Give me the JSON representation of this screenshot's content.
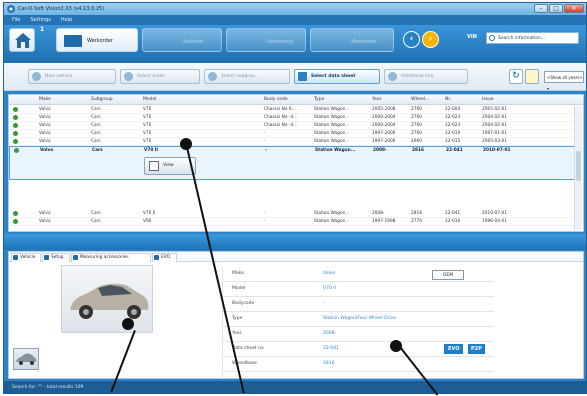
{
  "window": {
    "title": "Car-O-Soft Vision2 X3 (v4.13.0.25)",
    "buttons": [
      "–",
      "□",
      "✕"
    ]
  },
  "menu": [
    "File",
    "Settings",
    "Help"
  ],
  "toolbar": {
    "tab_number": "1",
    "active_tab": "Werkorder",
    "ghost_tabs": [
      "Selectie",
      "Uitvoering",
      "Werkorder"
    ],
    "vin_label": "VIN",
    "search_placeholder": "Search information..."
  },
  "breadcrumbs": [
    "New vehicle",
    "Select make",
    "Select subgrou...",
    "Select data sheet",
    "Additional info"
  ],
  "year_filter": "<Show all years>",
  "grid": {
    "headers": [
      "Make",
      "Subgroup",
      "Model",
      "Body code",
      "Type",
      "Year",
      "Wheel...",
      "Nr.",
      "Issue"
    ],
    "rows": [
      [
        "Volvo",
        "Cars",
        "V70",
        "Chassis No 6...",
        "Station Wagon...",
        "2005-2008",
        "2760",
        "22-004",
        "2005-02-01"
      ],
      [
        "Volvo",
        "Cars",
        "V70",
        "Chassis No -4...",
        "Station Wagon...",
        "2000-2004",
        "2760",
        "22-023",
        "2004-02-01"
      ],
      [
        "Volvo",
        "Cars",
        "V70",
        "Chassis No -4...",
        "Station Wagon...",
        "2000-2004",
        "2760",
        "22-023",
        "2004-02-01"
      ],
      [
        "Volvo",
        "Cars",
        "V70",
        "-",
        "Station Wagon...",
        "1997-2000",
        "2760",
        "22-019",
        "1997-01-01"
      ],
      [
        "Volvo",
        "Cars",
        "V70",
        "-",
        "Station Wagon...",
        "1997-2000",
        "2660",
        "22-015",
        "2005-03-01"
      ]
    ],
    "selected_row": [
      "Volvo",
      "Cars",
      "V70 II",
      "-",
      "Station Wagon...",
      "2008-",
      "2816",
      "22-041",
      "2010-07-01"
    ],
    "view_button": "View",
    "after_rows": [
      [
        "Volvo",
        "Cars",
        "V70 II",
        "-",
        "Station Wagon...",
        "2008-",
        "2816",
        "22-041",
        "2010-07-01"
      ],
      [
        "Volvo",
        "Cars",
        "V90",
        "-",
        "Station Wagon...",
        "1997-1998",
        "2770",
        "22-016",
        "1996-04-01"
      ]
    ]
  },
  "detail_tabs": [
    "Vehicle",
    "Setup",
    "Measuring accessories",
    "EVO"
  ],
  "vehicle": [
    [
      "Make",
      "Volvo"
    ],
    [
      "Model",
      "V70 II"
    ],
    [
      "Bodycode",
      "-"
    ],
    [
      "Type",
      "Station Wagon/Four Wheel Drive"
    ],
    [
      "Year",
      "2008-"
    ],
    [
      "Data sheet no",
      "22-041"
    ],
    [
      "Wheelbase",
      "2816"
    ]
  ],
  "oem_label": "OEM",
  "evo_label": "EVO",
  "p2p_label": "P2P",
  "status_text": "Search for: \"\" - total results 109"
}
